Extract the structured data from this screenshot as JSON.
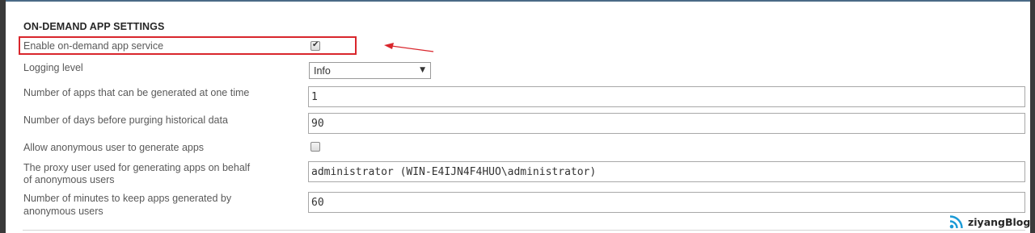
{
  "section": {
    "title": "ON-DEMAND APP SETTINGS"
  },
  "settings": {
    "enable_service": {
      "label": "Enable on-demand app service",
      "checked": true
    },
    "logging_level": {
      "label": "Logging level",
      "value": "Info",
      "icon": "chevron-down-icon"
    },
    "apps_at_one_time": {
      "label": "Number of apps that can be generated at one time",
      "value": "1"
    },
    "days_before_purge": {
      "label": "Number of days before purging historical data",
      "value": "90"
    },
    "allow_anonymous": {
      "label": "Allow anonymous user to generate apps",
      "checked": false
    },
    "proxy_user": {
      "label_line1": "The proxy user used for generating apps on behalf",
      "label_line2": "of anonymous users",
      "value": "administrator (WIN-E4IJN4F4HUO\\administrator)"
    },
    "minutes_keep_apps": {
      "label_line1": "Number of minutes to keep apps generated by",
      "label_line2": "anonymous users",
      "value": "60"
    }
  },
  "annotation": {
    "highlight_color": "#d9262c",
    "arrow_color": "#d9262c"
  },
  "watermark": {
    "text": "ziyangBlog",
    "icon": "rss-feed-icon",
    "icon_color": "#1a9ad6"
  }
}
